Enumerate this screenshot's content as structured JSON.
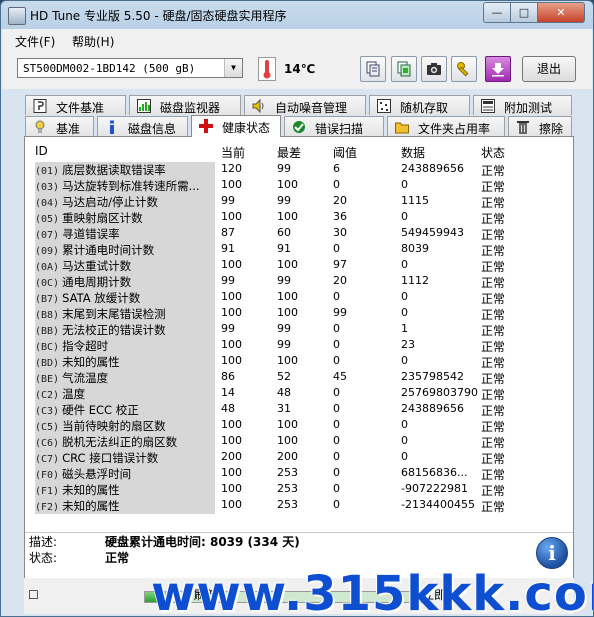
{
  "window": {
    "title": "HD Tune 专业版 5.50 - 硬盘/固态硬盘实用程序",
    "minimize": "—",
    "maximize": "□",
    "close": "✕"
  },
  "menu": {
    "file": "文件(F)",
    "help": "帮助(H)"
  },
  "toolbar": {
    "drive": "ST500DM002-1BD142 (500 gB)",
    "temperature": "14℃",
    "exit_label": "退出"
  },
  "tabs_top": [
    {
      "label": "文件基准",
      "icon": "file-benchmark-icon"
    },
    {
      "label": "磁盘监视器",
      "icon": "disk-monitor-icon"
    },
    {
      "label": "自动噪音管理",
      "icon": "speaker-icon"
    },
    {
      "label": "随机存取",
      "icon": "random-access-icon"
    },
    {
      "label": "附加测试",
      "icon": "extra-tests-icon"
    }
  ],
  "tabs_bottom": [
    {
      "label": "基准",
      "icon": "benchmark-icon"
    },
    {
      "label": "磁盘信息",
      "icon": "info-icon"
    },
    {
      "label": "健康状态",
      "icon": "health-cross-icon"
    },
    {
      "label": "错误扫描",
      "icon": "error-scan-icon"
    },
    {
      "label": "文件夹占用率",
      "icon": "folder-icon"
    },
    {
      "label": "擦除",
      "icon": "trash-icon"
    }
  ],
  "table": {
    "headers": {
      "id": "ID",
      "current": "当前",
      "worst": "最差",
      "threshold": "阈值",
      "data": "数据",
      "status": "状态"
    },
    "rows": [
      {
        "id": "(01)",
        "name": "底层数据读取错误率",
        "current": "120",
        "worst": "99",
        "threshold": "6",
        "data": "243889656",
        "status": "正常"
      },
      {
        "id": "(03)",
        "name": "马达旋转到标准转速所需...",
        "current": "100",
        "worst": "100",
        "threshold": "0",
        "data": "0",
        "status": "正常"
      },
      {
        "id": "(04)",
        "name": "马达启动/停止计数",
        "current": "99",
        "worst": "99",
        "threshold": "20",
        "data": "1115",
        "status": "正常"
      },
      {
        "id": "(05)",
        "name": "重映射扇区计数",
        "current": "100",
        "worst": "100",
        "threshold": "36",
        "data": "0",
        "status": "正常"
      },
      {
        "id": "(07)",
        "name": "寻道错误率",
        "current": "87",
        "worst": "60",
        "threshold": "30",
        "data": "549459943",
        "status": "正常"
      },
      {
        "id": "(09)",
        "name": "累计通电时间计数",
        "current": "91",
        "worst": "91",
        "threshold": "0",
        "data": "8039",
        "status": "正常"
      },
      {
        "id": "(0A)",
        "name": "马达重试计数",
        "current": "100",
        "worst": "100",
        "threshold": "97",
        "data": "0",
        "status": "正常"
      },
      {
        "id": "(0C)",
        "name": "通电周期计数",
        "current": "99",
        "worst": "99",
        "threshold": "20",
        "data": "1112",
        "status": "正常"
      },
      {
        "id": "(B7)",
        "name": "SATA 放缓计数",
        "current": "100",
        "worst": "100",
        "threshold": "0",
        "data": "0",
        "status": "正常"
      },
      {
        "id": "(B8)",
        "name": "末尾到末尾错误检测",
        "current": "100",
        "worst": "100",
        "threshold": "99",
        "data": "0",
        "status": "正常"
      },
      {
        "id": "(BB)",
        "name": "无法校正的错误计数",
        "current": "99",
        "worst": "99",
        "threshold": "0",
        "data": "1",
        "status": "正常"
      },
      {
        "id": "(BC)",
        "name": "指令超时",
        "current": "100",
        "worst": "99",
        "threshold": "0",
        "data": "23",
        "status": "正常"
      },
      {
        "id": "(BD)",
        "name": "未知的属性",
        "current": "100",
        "worst": "100",
        "threshold": "0",
        "data": "0",
        "status": "正常"
      },
      {
        "id": "(BE)",
        "name": "气流温度",
        "current": "86",
        "worst": "52",
        "threshold": "45",
        "data": "235798542",
        "status": "正常"
      },
      {
        "id": "(C2)",
        "name": "温度",
        "current": "14",
        "worst": "48",
        "threshold": "0",
        "data": "25769803790",
        "status": "正常"
      },
      {
        "id": "(C3)",
        "name": "硬件 ECC 校正",
        "current": "48",
        "worst": "31",
        "threshold": "0",
        "data": "243889656",
        "status": "正常"
      },
      {
        "id": "(C5)",
        "name": "当前待映射的扇区数",
        "current": "100",
        "worst": "100",
        "threshold": "0",
        "data": "0",
        "status": "正常"
      },
      {
        "id": "(C6)",
        "name": "脱机无法纠正的扇区数",
        "current": "100",
        "worst": "100",
        "threshold": "0",
        "data": "0",
        "status": "正常"
      },
      {
        "id": "(C7)",
        "name": "CRC 接口错误计数",
        "current": "200",
        "worst": "200",
        "threshold": "0",
        "data": "0",
        "status": "正常"
      },
      {
        "id": "(F0)",
        "name": "磁头悬浮时间",
        "current": "100",
        "worst": "253",
        "threshold": "0",
        "data": "68156836...",
        "status": "正常"
      },
      {
        "id": "(F1)",
        "name": "未知的属性",
        "current": "100",
        "worst": "253",
        "threshold": "0",
        "data": "-907222981",
        "status": "正常"
      },
      {
        "id": "(F2)",
        "name": "未知的属性",
        "current": "100",
        "worst": "253",
        "threshold": "0",
        "data": "-2134400455",
        "status": "正常"
      }
    ]
  },
  "details": {
    "desc_label": "描述:",
    "desc_value": "硬盘累计通电时间: 8039 (334 天)",
    "status_label": "状态:",
    "status_value": "正常"
  },
  "bottom": {
    "refresh_label_fragment": "刷新",
    "now_label_fragment": "立即",
    "progress_percent": 10
  },
  "watermark": "www.315kkk.com"
}
